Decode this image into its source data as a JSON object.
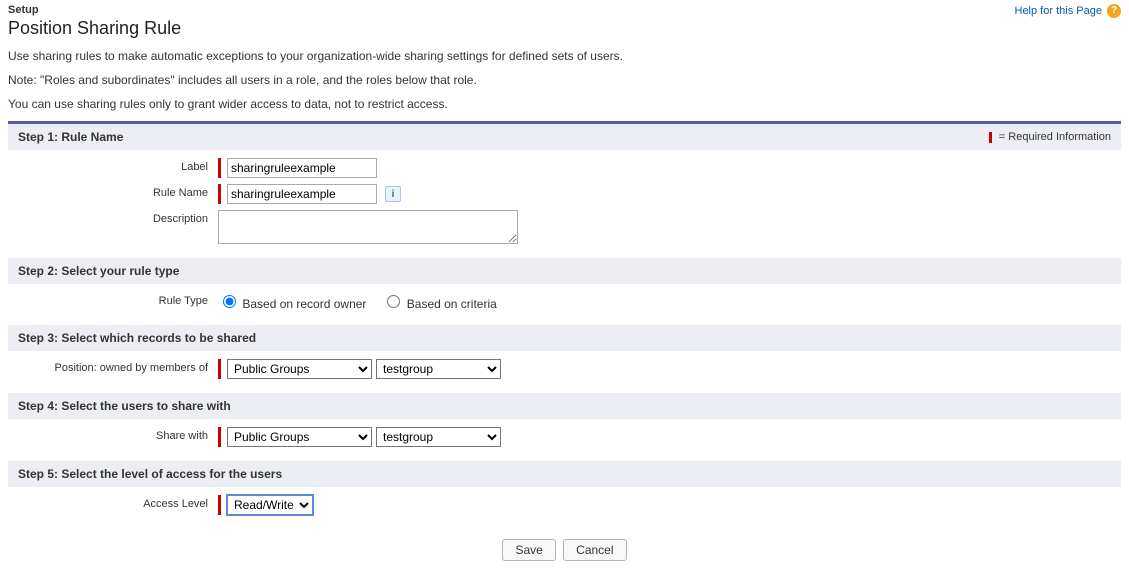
{
  "header": {
    "setup": "Setup",
    "title": "Position Sharing Rule",
    "help_label": "Help for this Page",
    "help_icon": "?"
  },
  "intro": {
    "p1": "Use sharing rules to make automatic exceptions to your organization-wide sharing settings for defined sets of users.",
    "p2": "Note: \"Roles and subordinates\" includes all users in a role, and the roles below that role.",
    "p3": "You can use sharing rules only to grant wider access to data, not to restrict access."
  },
  "required_text": "= Required Information",
  "step1": {
    "heading": "Step 1: Rule Name",
    "label_label": "Label",
    "label_value": "sharingruleexample",
    "rulename_label": "Rule Name",
    "rulename_value": "sharingruleexample",
    "description_label": "Description",
    "description_value": ""
  },
  "step2": {
    "heading": "Step 2: Select your rule type",
    "ruletype_label": "Rule Type",
    "option_owner": "Based on record owner",
    "option_criteria": "Based on criteria",
    "selected": "owner"
  },
  "step3": {
    "heading": "Step 3: Select which records to be shared",
    "owned_label": "Position: owned by members of",
    "category": "Public Groups",
    "value": "testgroup"
  },
  "step4": {
    "heading": "Step 4: Select the users to share with",
    "share_label": "Share with",
    "category": "Public Groups",
    "value": "testgroup"
  },
  "step5": {
    "heading": "Step 5: Select the level of access for the users",
    "access_label": "Access Level",
    "access_value": "Read/Write"
  },
  "buttons": {
    "save": "Save",
    "cancel": "Cancel"
  }
}
